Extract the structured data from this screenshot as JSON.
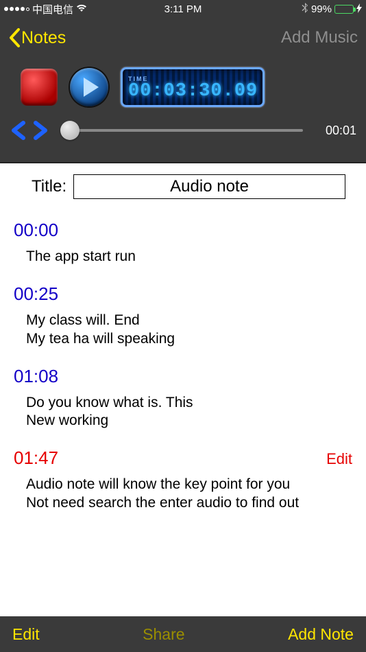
{
  "status": {
    "carrier": "中国电信",
    "time": "3:11 PM",
    "battery_pct": "99%"
  },
  "nav": {
    "back_label": "Notes",
    "right_label": "Add Music"
  },
  "player": {
    "lcd_label": "TIME",
    "lcd_time": "00:03:30.09",
    "slider_end": "00:01"
  },
  "title": {
    "label": "Title:",
    "value": "Audio note"
  },
  "notes": [
    {
      "stamp": "00:00",
      "text": "The app start run",
      "active": false
    },
    {
      "stamp": "00:25",
      "text": "My class will. End\nMy tea ha will speaking",
      "active": false
    },
    {
      "stamp": "01:08",
      "text": "Do you know what is. This\nNew working",
      "active": false
    },
    {
      "stamp": "01:47",
      "text": "Audio note will know the key point for you\nNot need search the enter audio to find out",
      "active": true,
      "edit_label": "Edit"
    }
  ],
  "toolbar": {
    "left": "Edit",
    "center": "Share",
    "right": "Add Note"
  }
}
